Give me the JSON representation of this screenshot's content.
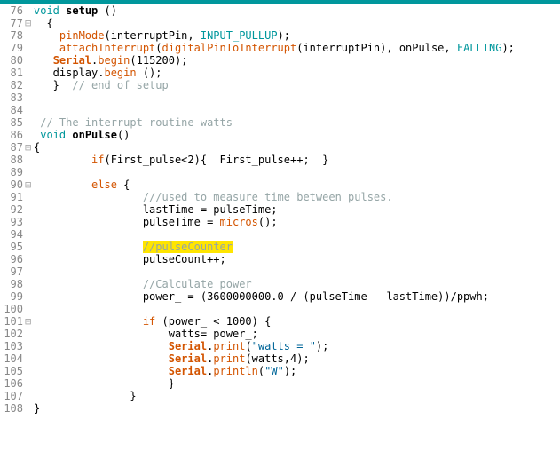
{
  "lines": [
    {
      "n": 76,
      "f": "",
      "c": [
        {
          "t": "kw-type",
          "v": "void"
        },
        {
          "t": "",
          "v": " "
        },
        {
          "t": "fn-black",
          "v": "setup"
        },
        {
          "t": "",
          "v": " ()"
        }
      ]
    },
    {
      "n": 77,
      "f": "⊟",
      "c": [
        {
          "t": "",
          "v": "  {"
        }
      ]
    },
    {
      "n": 78,
      "f": "",
      "c": [
        {
          "t": "",
          "v": "    "
        },
        {
          "t": "fn-orange",
          "v": "pinMode"
        },
        {
          "t": "",
          "v": "(interruptPin, "
        },
        {
          "t": "const-teal",
          "v": "INPUT_PULLUP"
        },
        {
          "t": "",
          "v": ");"
        }
      ]
    },
    {
      "n": 79,
      "f": "",
      "c": [
        {
          "t": "",
          "v": "    "
        },
        {
          "t": "fn-orange",
          "v": "attachInterrupt"
        },
        {
          "t": "",
          "v": "("
        },
        {
          "t": "fn-orange",
          "v": "digitalPinToInterrupt"
        },
        {
          "t": "",
          "v": "(interruptPin), onPulse, "
        },
        {
          "t": "const-teal",
          "v": "FALLING"
        },
        {
          "t": "",
          "v": ");"
        }
      ]
    },
    {
      "n": 80,
      "f": "",
      "c": [
        {
          "t": "",
          "v": "   "
        },
        {
          "t": "serial",
          "v": "Serial"
        },
        {
          "t": "",
          "v": "."
        },
        {
          "t": "fn-orange",
          "v": "begin"
        },
        {
          "t": "",
          "v": "(115200);"
        }
      ]
    },
    {
      "n": 81,
      "f": "",
      "c": [
        {
          "t": "",
          "v": "   display."
        },
        {
          "t": "fn-orange",
          "v": "begin"
        },
        {
          "t": "",
          "v": " ();"
        }
      ]
    },
    {
      "n": 82,
      "f": "",
      "c": [
        {
          "t": "",
          "v": "   }  "
        },
        {
          "t": "comment",
          "v": "// end of setup"
        }
      ]
    },
    {
      "n": 83,
      "f": "",
      "c": [
        {
          "t": "",
          "v": ""
        }
      ]
    },
    {
      "n": 84,
      "f": "",
      "c": [
        {
          "t": "",
          "v": ""
        }
      ]
    },
    {
      "n": 85,
      "f": "",
      "c": [
        {
          "t": "",
          "v": " "
        },
        {
          "t": "comment",
          "v": "// The interrupt routine watts"
        }
      ]
    },
    {
      "n": 86,
      "f": "",
      "c": [
        {
          "t": "",
          "v": " "
        },
        {
          "t": "kw-type",
          "v": "void"
        },
        {
          "t": "",
          "v": " "
        },
        {
          "t": "fn-black",
          "v": "onPulse"
        },
        {
          "t": "",
          "v": "()"
        }
      ]
    },
    {
      "n": 87,
      "f": "⊟",
      "c": [
        {
          "t": "",
          "v": "{"
        }
      ]
    },
    {
      "n": 88,
      "f": "",
      "c": [
        {
          "t": "",
          "v": "         "
        },
        {
          "t": "fn-orange",
          "v": "if"
        },
        {
          "t": "",
          "v": "(First_pulse<2){  First_pulse++;  }"
        }
      ]
    },
    {
      "n": 89,
      "f": "",
      "c": [
        {
          "t": "",
          "v": ""
        }
      ]
    },
    {
      "n": 90,
      "f": "⊟",
      "c": [
        {
          "t": "",
          "v": "         "
        },
        {
          "t": "fn-orange",
          "v": "else"
        },
        {
          "t": "",
          "v": " {"
        }
      ]
    },
    {
      "n": 91,
      "f": "",
      "c": [
        {
          "t": "",
          "v": "                 "
        },
        {
          "t": "comment",
          "v": "///used to measure time between pulses."
        }
      ]
    },
    {
      "n": 92,
      "f": "",
      "c": [
        {
          "t": "",
          "v": "                 lastTime = pulseTime;"
        }
      ]
    },
    {
      "n": 93,
      "f": "",
      "c": [
        {
          "t": "",
          "v": "                 pulseTime = "
        },
        {
          "t": "fn-orange",
          "v": "micros"
        },
        {
          "t": "",
          "v": "();"
        }
      ]
    },
    {
      "n": 94,
      "f": "",
      "c": [
        {
          "t": "",
          "v": ""
        }
      ]
    },
    {
      "n": 95,
      "f": "",
      "c": [
        {
          "t": "",
          "v": "                 "
        },
        {
          "t": "highlight",
          "v": "//pulseCounter"
        }
      ]
    },
    {
      "n": 96,
      "f": "",
      "c": [
        {
          "t": "",
          "v": "                 pulseCount++;"
        }
      ]
    },
    {
      "n": 97,
      "f": "",
      "c": [
        {
          "t": "",
          "v": ""
        }
      ]
    },
    {
      "n": 98,
      "f": "",
      "c": [
        {
          "t": "",
          "v": "                 "
        },
        {
          "t": "comment",
          "v": "//Calculate power"
        }
      ]
    },
    {
      "n": 99,
      "f": "",
      "c": [
        {
          "t": "",
          "v": "                 power_ = (3600000000.0 / (pulseTime - lastTime))/ppwh;"
        }
      ]
    },
    {
      "n": 100,
      "f": "",
      "c": [
        {
          "t": "",
          "v": ""
        }
      ]
    },
    {
      "n": 101,
      "f": "⊟",
      "c": [
        {
          "t": "",
          "v": "                 "
        },
        {
          "t": "fn-orange",
          "v": "if"
        },
        {
          "t": "",
          "v": " (power_ < 1000) {"
        }
      ]
    },
    {
      "n": 102,
      "f": "",
      "c": [
        {
          "t": "",
          "v": "                     watts= power_;"
        }
      ]
    },
    {
      "n": 103,
      "f": "",
      "c": [
        {
          "t": "",
          "v": "                     "
        },
        {
          "t": "serial",
          "v": "Serial"
        },
        {
          "t": "",
          "v": "."
        },
        {
          "t": "fn-orange",
          "v": "print"
        },
        {
          "t": "",
          "v": "("
        },
        {
          "t": "string",
          "v": "\"watts = \""
        },
        {
          "t": "",
          "v": ");"
        }
      ]
    },
    {
      "n": 104,
      "f": "",
      "c": [
        {
          "t": "",
          "v": "                     "
        },
        {
          "t": "serial",
          "v": "Serial"
        },
        {
          "t": "",
          "v": "."
        },
        {
          "t": "fn-orange",
          "v": "print"
        },
        {
          "t": "",
          "v": "(watts,4);"
        }
      ]
    },
    {
      "n": 105,
      "f": "",
      "c": [
        {
          "t": "",
          "v": "                     "
        },
        {
          "t": "serial",
          "v": "Serial"
        },
        {
          "t": "",
          "v": "."
        },
        {
          "t": "fn-orange",
          "v": "println"
        },
        {
          "t": "",
          "v": "("
        },
        {
          "t": "string",
          "v": "\"W\""
        },
        {
          "t": "",
          "v": ");"
        }
      ]
    },
    {
      "n": 106,
      "f": "",
      "c": [
        {
          "t": "",
          "v": "                     }"
        }
      ]
    },
    {
      "n": 107,
      "f": "",
      "c": [
        {
          "t": "",
          "v": "               }"
        }
      ]
    },
    {
      "n": 108,
      "f": "",
      "c": [
        {
          "t": "",
          "v": "}"
        }
      ]
    }
  ]
}
